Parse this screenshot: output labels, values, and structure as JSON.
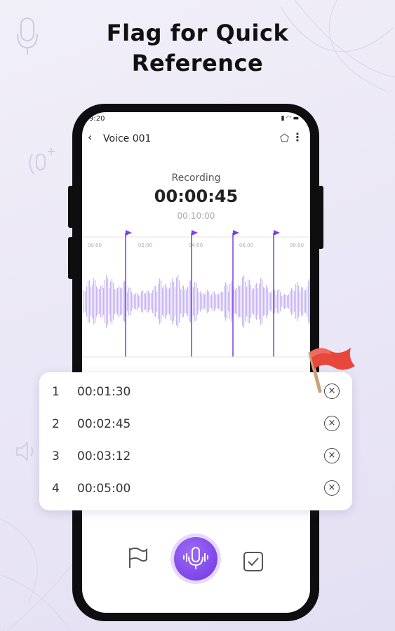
{
  "headline": "Flag for Quick\nReference",
  "status_bar": {
    "time": "9:20",
    "icons": "signal wifi battery"
  },
  "app_bar": {
    "back_icon": "chevron-left-icon",
    "title": "Voice 001",
    "share_icon": "share-icon",
    "more_icon": "more-vertical-icon"
  },
  "recording": {
    "label": "Recording",
    "elapsed": "00:00:45",
    "limit": "00:10:00"
  },
  "timeline": {
    "ticks": [
      "00:00",
      "02:00",
      "04:00",
      "06:00",
      "08:00"
    ]
  },
  "markers_fraction": [
    0.19,
    0.48,
    0.66,
    0.84
  ],
  "flags": [
    {
      "num": "1",
      "time": "00:01:30"
    },
    {
      "num": "2",
      "time": "00:02:45"
    },
    {
      "num": "3",
      "time": "00:03:12"
    },
    {
      "num": "4",
      "time": "00:05:00"
    }
  ],
  "controls": {
    "flag_icon": "flag-icon",
    "mic_icon": "microphone-icon",
    "save_icon": "check-square-icon"
  },
  "colors": {
    "accent": "#7b3fe4",
    "wave": "#c7b5f4",
    "flag": "#e8473b"
  }
}
